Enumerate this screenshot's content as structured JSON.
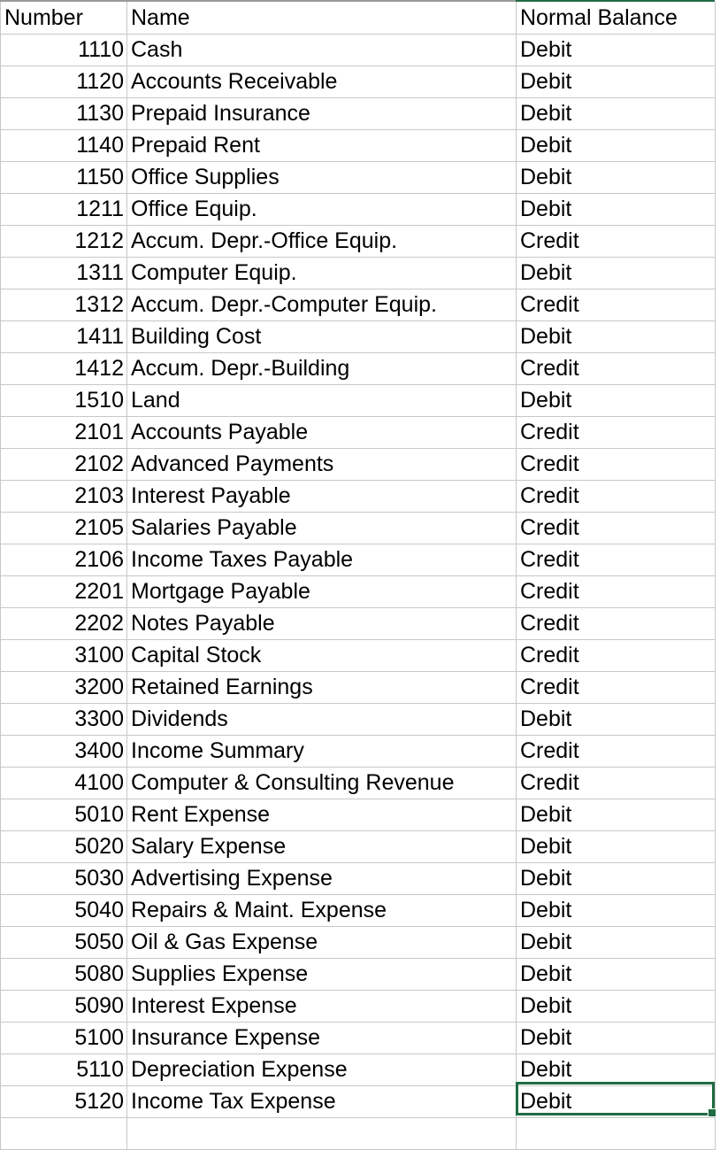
{
  "table": {
    "columns": [
      {
        "key": "number",
        "label": "Number",
        "align": "right"
      },
      {
        "key": "name",
        "label": "Name",
        "align": "left"
      },
      {
        "key": "balance",
        "label": "Normal Balance",
        "align": "left"
      }
    ],
    "rows": [
      {
        "number": "1110",
        "name": "Cash",
        "balance": "Debit"
      },
      {
        "number": "1120",
        "name": "Accounts Receivable",
        "balance": "Debit"
      },
      {
        "number": "1130",
        "name": "Prepaid Insurance",
        "balance": "Debit"
      },
      {
        "number": "1140",
        "name": "Prepaid Rent",
        "balance": "Debit"
      },
      {
        "number": "1150",
        "name": "Office Supplies",
        "balance": "Debit"
      },
      {
        "number": "1211",
        "name": "Office Equip.",
        "balance": "Debit"
      },
      {
        "number": "1212",
        "name": "Accum. Depr.-Office Equip.",
        "balance": "Credit"
      },
      {
        "number": "1311",
        "name": "Computer Equip.",
        "balance": "Debit"
      },
      {
        "number": "1312",
        "name": "Accum. Depr.-Computer Equip.",
        "balance": "Credit"
      },
      {
        "number": "1411",
        "name": "Building Cost",
        "balance": "Debit"
      },
      {
        "number": "1412",
        "name": "Accum. Depr.-Building",
        "balance": "Credit"
      },
      {
        "number": "1510",
        "name": "Land",
        "balance": "Debit"
      },
      {
        "number": "2101",
        "name": "Accounts Payable",
        "balance": "Credit"
      },
      {
        "number": "2102",
        "name": "Advanced Payments",
        "balance": "Credit"
      },
      {
        "number": "2103",
        "name": "Interest Payable",
        "balance": "Credit"
      },
      {
        "number": "2105",
        "name": "Salaries Payable",
        "balance": "Credit"
      },
      {
        "number": "2106",
        "name": "Income Taxes Payable",
        "balance": "Credit"
      },
      {
        "number": "2201",
        "name": "Mortgage Payable",
        "balance": "Credit"
      },
      {
        "number": "2202",
        "name": "Notes Payable",
        "balance": "Credit"
      },
      {
        "number": "3100",
        "name": "Capital Stock",
        "balance": "Credit"
      },
      {
        "number": "3200",
        "name": "Retained Earnings",
        "balance": "Credit"
      },
      {
        "number": "3300",
        "name": "Dividends",
        "balance": "Debit"
      },
      {
        "number": "3400",
        "name": "Income Summary",
        "balance": "Credit"
      },
      {
        "number": "4100",
        "name": "Computer & Consulting Revenue",
        "balance": "Credit"
      },
      {
        "number": "5010",
        "name": "Rent Expense",
        "balance": "Debit"
      },
      {
        "number": "5020",
        "name": "Salary Expense",
        "balance": "Debit"
      },
      {
        "number": "5030",
        "name": "Advertising Expense",
        "balance": "Debit"
      },
      {
        "number": "5040",
        "name": "Repairs & Maint. Expense",
        "balance": "Debit"
      },
      {
        "number": "5050",
        "name": "Oil & Gas Expense",
        "balance": "Debit"
      },
      {
        "number": "5080",
        "name": "Supplies Expense",
        "balance": "Debit"
      },
      {
        "number": "5090",
        "name": "Interest Expense",
        "balance": "Debit"
      },
      {
        "number": "5100",
        "name": "Insurance Expense",
        "balance": "Debit"
      },
      {
        "number": "5110",
        "name": "Depreciation Expense",
        "balance": "Debit"
      },
      {
        "number": "5120",
        "name": "Income Tax Expense",
        "balance": "Debit"
      }
    ]
  },
  "selection": {
    "row_index": 33,
    "column_key": "balance",
    "value": "Debit",
    "border_color": "#1f6b43"
  },
  "colors": {
    "grid_line": "#c8c8c8",
    "top_rule": "#9a9a9a",
    "text": "#000000",
    "background": "#ffffff",
    "selection_green": "#1f6b43"
  }
}
